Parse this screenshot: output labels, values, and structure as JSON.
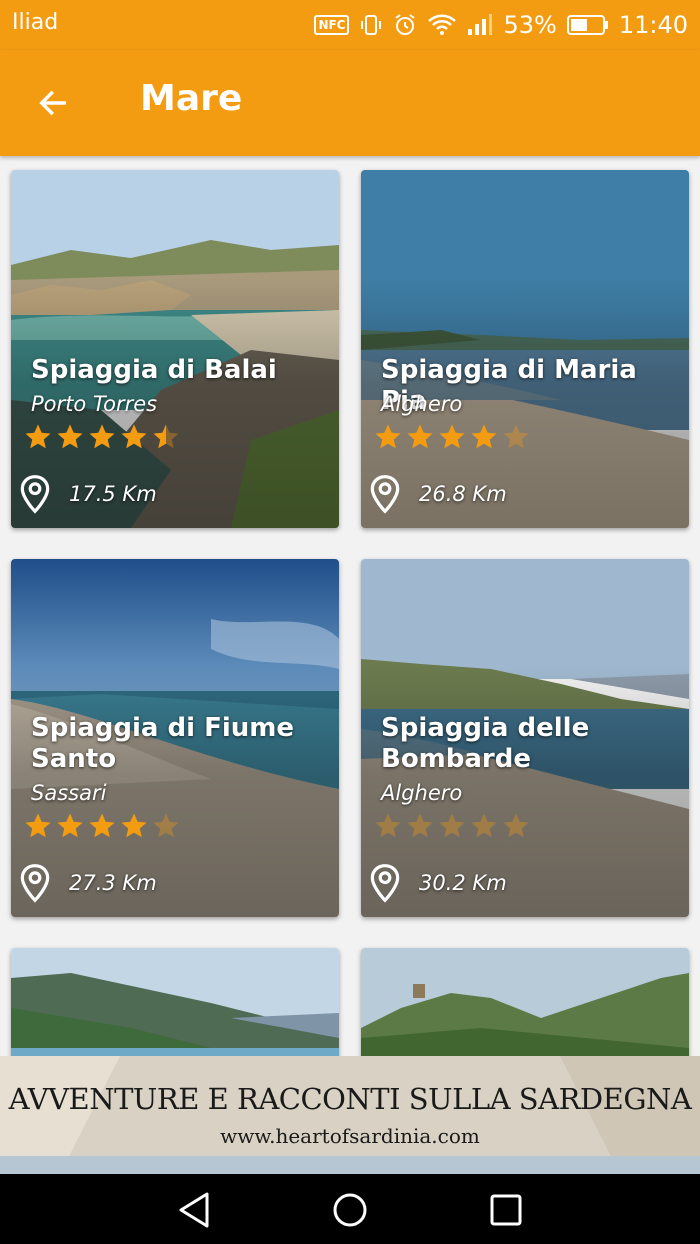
{
  "status_bar": {
    "carrier": "Iliad",
    "nfc_label": "NFC",
    "battery_percent": "53%",
    "battery_level": 0.53,
    "time": "11:40",
    "icons": [
      "nfc-icon",
      "vibrate-icon",
      "alarm-icon",
      "wifi-icon",
      "signal-icon",
      "battery-icon"
    ]
  },
  "app_bar": {
    "title": "Mare",
    "back_icon": "arrow-left-icon"
  },
  "beaches": [
    {
      "name": "Spiaggia di Balai",
      "town": "Porto Torres",
      "rating": 4.5,
      "distance": "17.5 Km"
    },
    {
      "name": "Spiaggia di Maria Pia",
      "town": "Alghero",
      "rating": 4,
      "distance": "26.8 Km"
    },
    {
      "name": "Spiaggia di Fiume Santo",
      "town": "Sassari",
      "rating": 4,
      "distance": "27.3 Km"
    },
    {
      "name": "Spiaggia delle Bombarde",
      "town": "Alghero",
      "rating": 0,
      "distance": "30.2 Km"
    }
  ],
  "banner": {
    "headline": "AVVENTURE E RACCONTI SULLA SARDEGNA",
    "site": "www.heartofsardinia.com"
  },
  "nav_bar": {
    "icons": [
      "back-triangle-icon",
      "home-circle-icon",
      "recents-square-icon"
    ]
  },
  "colors": {
    "accent": "#f39c12",
    "star_filled": "#f39c12",
    "star_empty": "rgba(243,156,18,0.35)"
  }
}
